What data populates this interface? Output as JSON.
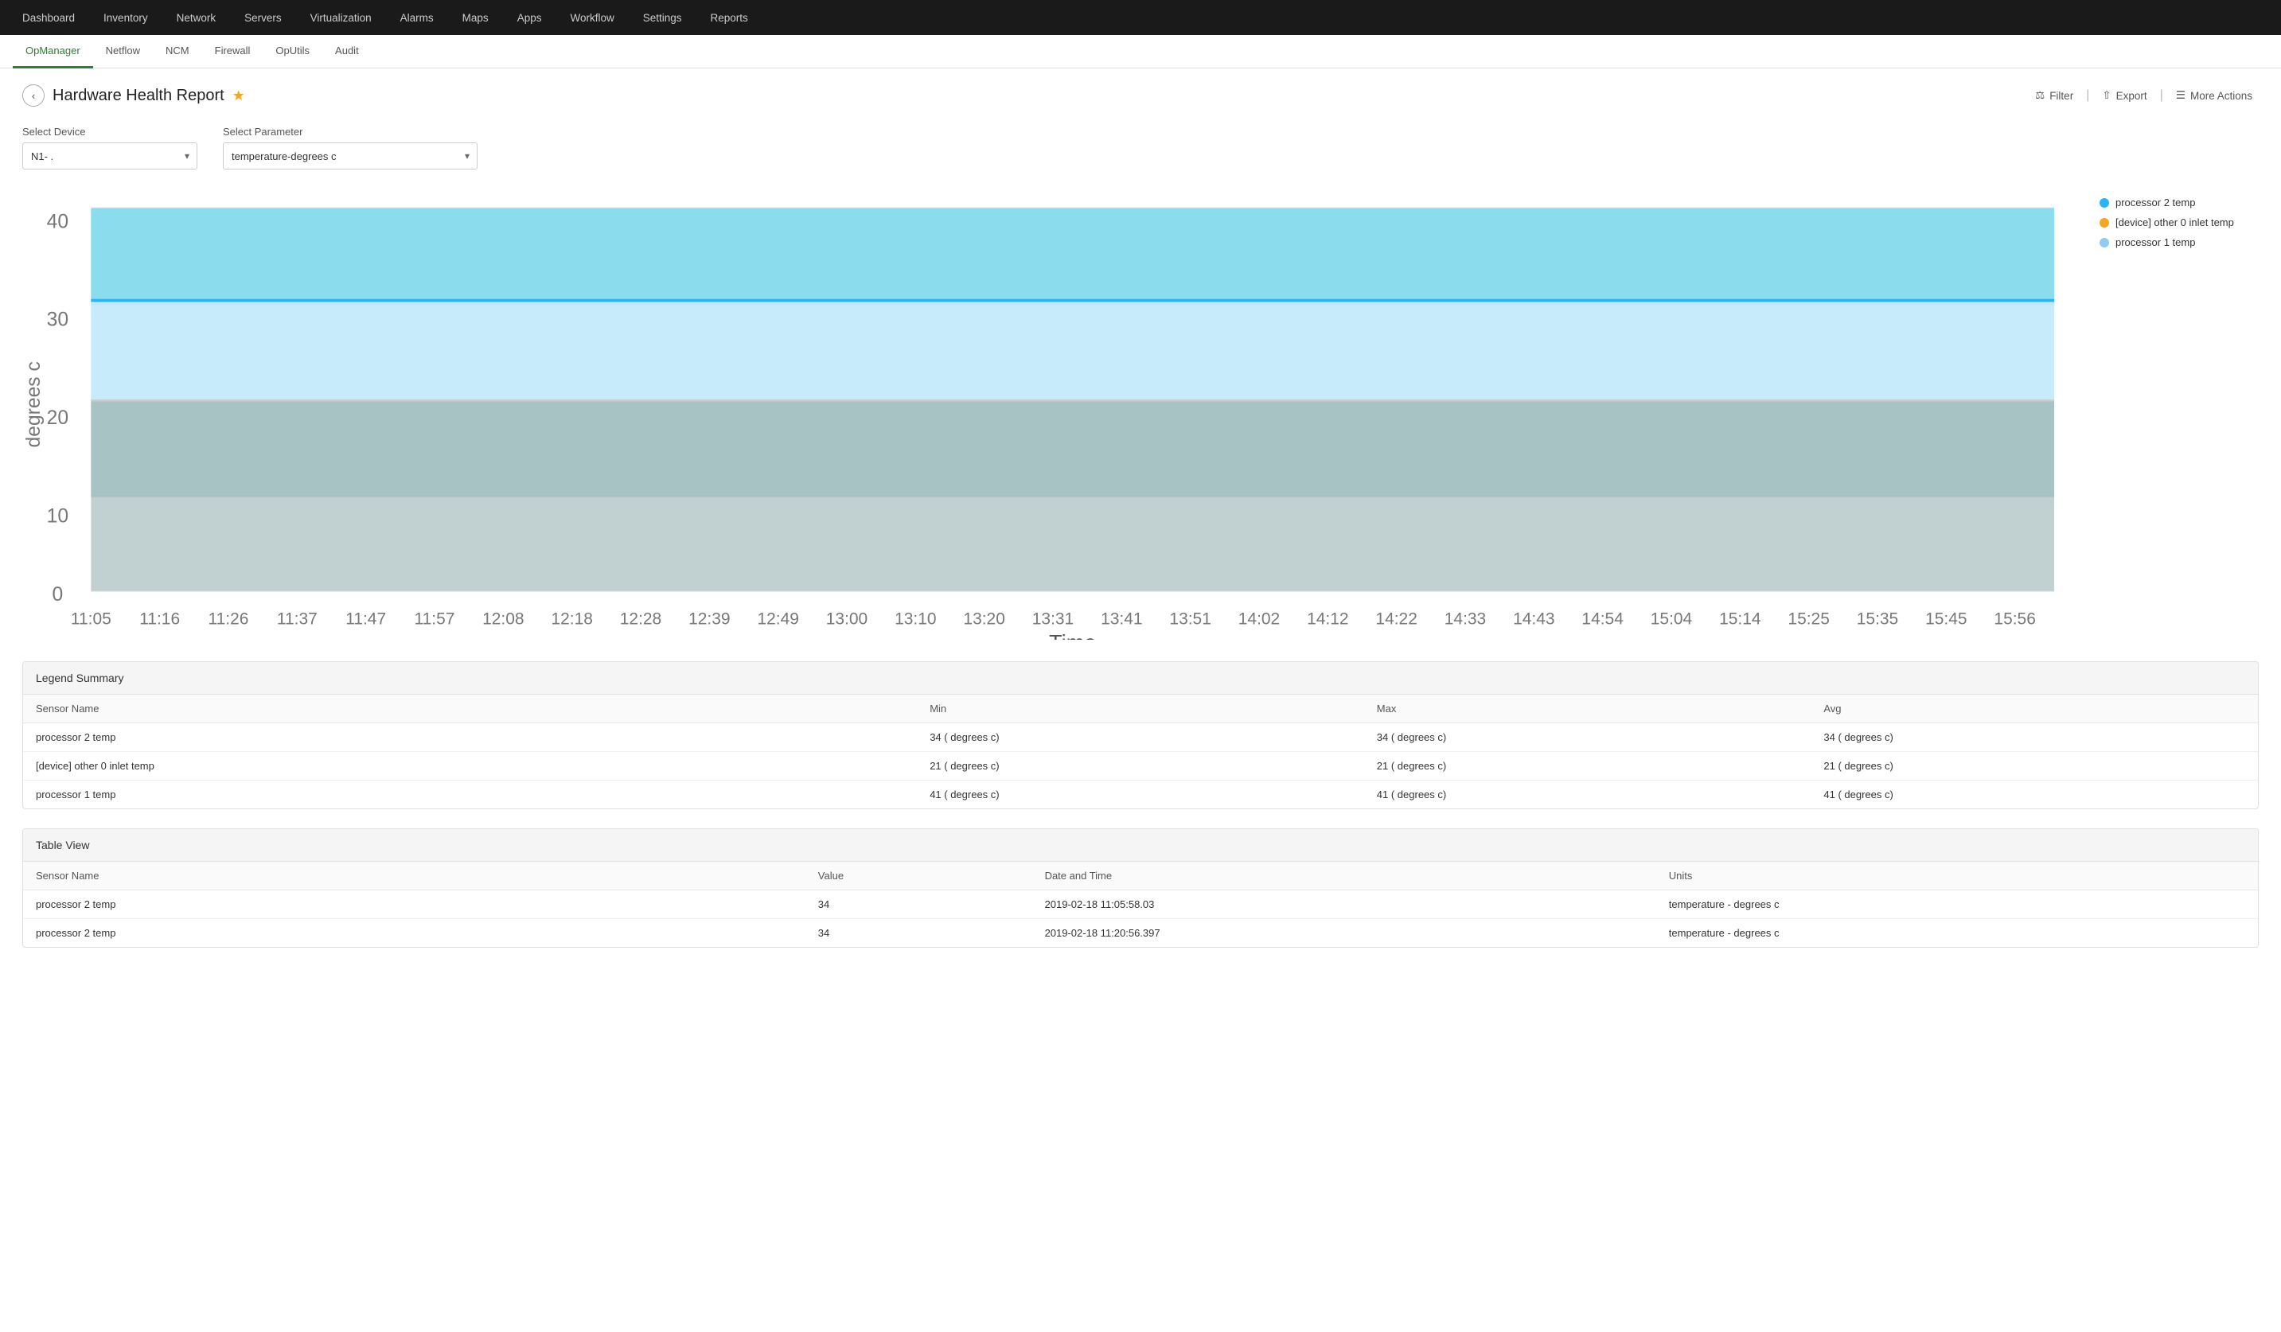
{
  "topNav": {
    "items": [
      {
        "id": "dashboard",
        "label": "Dashboard"
      },
      {
        "id": "inventory",
        "label": "Inventory"
      },
      {
        "id": "network",
        "label": "Network"
      },
      {
        "id": "servers",
        "label": "Servers"
      },
      {
        "id": "virtualization",
        "label": "Virtualization"
      },
      {
        "id": "alarms",
        "label": "Alarms"
      },
      {
        "id": "maps",
        "label": "Maps"
      },
      {
        "id": "apps",
        "label": "Apps"
      },
      {
        "id": "workflow",
        "label": "Workflow"
      },
      {
        "id": "settings",
        "label": "Settings"
      },
      {
        "id": "reports",
        "label": "Reports"
      }
    ]
  },
  "subNav": {
    "items": [
      {
        "id": "opmanager",
        "label": "OpManager",
        "active": true
      },
      {
        "id": "netflow",
        "label": "Netflow",
        "active": false
      },
      {
        "id": "ncm",
        "label": "NCM",
        "active": false
      },
      {
        "id": "firewall",
        "label": "Firewall",
        "active": false
      },
      {
        "id": "oputils",
        "label": "OpUtils",
        "active": false
      },
      {
        "id": "audit",
        "label": "Audit",
        "active": false
      }
    ]
  },
  "pageTitle": "Hardware Health Report",
  "actions": {
    "filter": "Filter",
    "export": "Export",
    "moreActions": "More Actions"
  },
  "form": {
    "deviceLabel": "Select Device",
    "deviceValue": "N1-        .",
    "paramLabel": "Select Parameter",
    "paramValue": "temperature-degrees c"
  },
  "chart": {
    "yAxisLabel": "degrees c",
    "xAxisLabel": "Time",
    "yTicks": [
      "0",
      "10",
      "20",
      "30",
      "40"
    ],
    "xTicks": [
      "11:05",
      "11:16",
      "11:26",
      "11:37",
      "11:47",
      "11:57",
      "12:08",
      "12:18",
      "12:28",
      "12:39",
      "12:49",
      "13:00",
      "13:10",
      "13:20",
      "13:31",
      "13:41",
      "13:51",
      "14:02",
      "14:12",
      "14:22",
      "14:33",
      "14:43",
      "14:54",
      "15:04",
      "15:14",
      "15:25",
      "15:35",
      "15:45",
      "15:56"
    ]
  },
  "legend": {
    "items": [
      {
        "label": "processor 2 temp",
        "color": "#29b6f6"
      },
      {
        "label": "[device] other 0 inlet temp",
        "color": "#f5a623"
      },
      {
        "label": "processor 1 temp",
        "color": "#90caf9"
      }
    ]
  },
  "legendSummary": {
    "title": "Legend Summary",
    "columns": [
      "Sensor Name",
      "Min",
      "Max",
      "Avg"
    ],
    "rows": [
      {
        "name": "processor 2 temp",
        "min": "34 ( degrees c)",
        "max": "34 ( degrees c)",
        "avg": "34 ( degrees c)"
      },
      {
        "name": "[device] other 0 inlet temp",
        "min": "21 ( degrees c)",
        "max": "21 ( degrees c)",
        "avg": "21 ( degrees c)"
      },
      {
        "name": "processor 1 temp",
        "min": "41 ( degrees c)",
        "max": "41 ( degrees c)",
        "avg": "41 ( degrees c)"
      }
    ]
  },
  "tableView": {
    "title": "Table View",
    "columns": [
      "Sensor Name",
      "Value",
      "Date and Time",
      "Units"
    ],
    "rows": [
      {
        "name": "processor 2 temp",
        "value": "34",
        "datetime": "2019-02-18 11:05:58.03",
        "units": "temperature - degrees c"
      },
      {
        "name": "processor 2 temp",
        "value": "34",
        "datetime": "2019-02-18 11:20:56.397",
        "units": "temperature - degrees c"
      }
    ]
  }
}
